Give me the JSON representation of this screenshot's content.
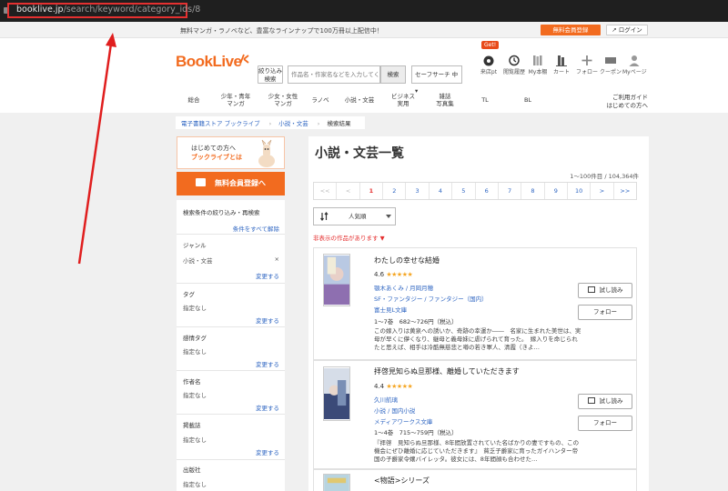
{
  "browser": {
    "url_domain": "booklive.jp",
    "url_path": "/search/keyword/category_ids/8"
  },
  "topbar": {
    "promo": "無料マンガ・ラノベなど、豊富なラインナップで100万冊以上配信中！",
    "register_label": "無料会員登録",
    "login_label": "ログイン"
  },
  "header": {
    "logo": "BookLive",
    "refine_label_1": "絞り込み",
    "refine_label_2": "検索",
    "search_placeholder": "作品名・作家名などを入力してください",
    "search_button": "検索",
    "safe_search": "セーフサーチ 中",
    "get_badge": "Get!",
    "icons": [
      {
        "label": "来店pt",
        "icon": "stamp-icon"
      },
      {
        "label": "閲覧履歴",
        "icon": "history-icon"
      },
      {
        "label": "My本棚",
        "icon": "bookshelf-icon"
      },
      {
        "label": "カート",
        "icon": "cart-icon"
      },
      {
        "label": "フォロー",
        "icon": "plus-icon"
      },
      {
        "label": "クーポン",
        "icon": "coupon-icon"
      },
      {
        "label": "Myページ",
        "icon": "user-icon"
      }
    ]
  },
  "categories": [
    {
      "l1": "総合",
      "l2": ""
    },
    {
      "l1": "少年・青年",
      "l2": "マンガ"
    },
    {
      "l1": "少女・女性",
      "l2": "マンガ"
    },
    {
      "l1": "ラノベ",
      "l2": ""
    },
    {
      "l1": "小説・文芸",
      "l2": ""
    },
    {
      "l1": "ビジネス",
      "l2": "実用"
    },
    {
      "l1": "雑誌",
      "l2": "写真集"
    },
    {
      "l1": "TL",
      "l2": ""
    },
    {
      "l1": "BL",
      "l2": ""
    }
  ],
  "help": {
    "l1": "ご利用ガイド",
    "l2": "はじめての方へ"
  },
  "breadcrumb": [
    "電子書籍ストア ブックライブ",
    "小説・文芸",
    "検索結果"
  ],
  "sidebar": {
    "banner_1": "はじめての方へ",
    "banner_2": "ブックライブとは",
    "register": "無料会員登録へ",
    "cond_title": "検索条件の絞り込み・再検索",
    "clear_all": "条件をすべて解除",
    "sections": [
      {
        "title": "ジャンル",
        "value": "小説・文芸",
        "link": "変更する",
        "remove": "×"
      },
      {
        "title": "タグ",
        "value": "指定なし",
        "link": "変更する"
      },
      {
        "title": "感情タグ",
        "value": "指定なし",
        "link": "変更する"
      },
      {
        "title": "作者名",
        "value": "指定なし",
        "link": "変更する"
      },
      {
        "title": "掲載誌",
        "value": "指定なし",
        "link": "変更する"
      },
      {
        "title": "出版社",
        "value": "指定なし",
        "link": ""
      }
    ]
  },
  "main": {
    "title": "小説・文芸一覧",
    "count": "1〜100件目 / 104,364件",
    "pager": [
      "<<",
      "<",
      "1",
      "2",
      "3",
      "4",
      "5",
      "6",
      "7",
      "8",
      "9",
      "10",
      ">",
      ">>"
    ],
    "current_page": "1",
    "sort": "人気順",
    "hidden_note": "非表示の作品があります ▼",
    "trial_label": "試し読み",
    "follow_label": "フォロー",
    "items": [
      {
        "title": "わたしの幸せな結婚",
        "rating": "4.6",
        "stars": "★★★★★",
        "authors": "顎木あくみ / 月岡月穂",
        "genre": "SF・ファンタジー / ファンタジー（国内）",
        "label": "富士見L文庫",
        "range": "1〜7巻　682〜726円（税込）",
        "desc": "この嫁入りは黄泉への誘いか、奇跡の幸運か――　名家に生まれた美世は、実母が早くに儚くなり、継母と義母妹に虐げられて育った。　嫁入りを命じられたと思えば、相手は冷酷無慈悲と噂の若き軍人、清霞（きよ…"
      },
      {
        "title": "拝啓見知らぬ旦那様、離婚していただきます",
        "rating": "4.4",
        "stars": "★★★★★",
        "authors": "久川航璃",
        "genre": "小説 / 国内小説",
        "label": "メディアワークス文庫",
        "range": "1〜4巻　715〜759円（税込）",
        "desc": "『拝啓　見知らぬ旦那様、8年間放置されていた名ばかりの妻ですもの、この機会にぜひ離婚に応じていただきます』　貧乏子爵家に育ったガイハンター帝国の子爵家令嬢バイレッタ。彼女には、8年間顔も合わせた…"
      },
      {
        "title": "<物語>シリーズ"
      }
    ]
  }
}
